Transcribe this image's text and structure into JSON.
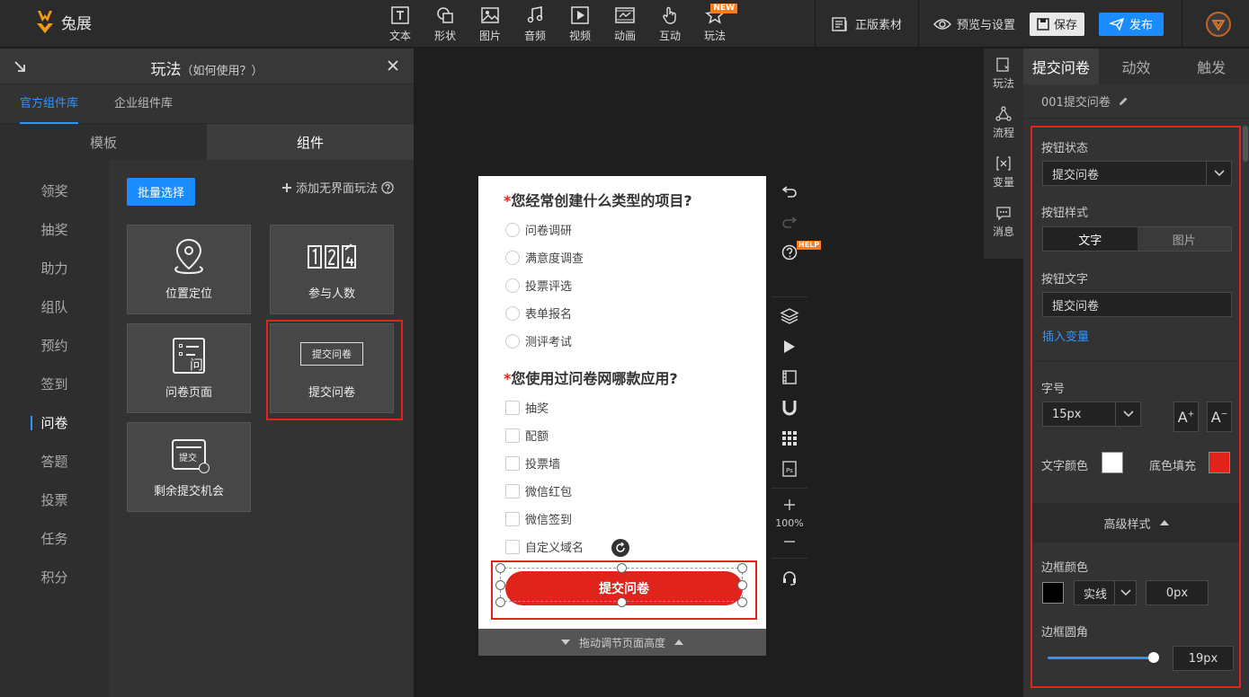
{
  "app": {
    "logo_text": "兔展"
  },
  "toolbar": {
    "tools": [
      {
        "label": "文本",
        "icon": "text-icon"
      },
      {
        "label": "形状",
        "icon": "shape-icon"
      },
      {
        "label": "图片",
        "icon": "image-icon"
      },
      {
        "label": "音频",
        "icon": "music-icon"
      },
      {
        "label": "视频",
        "icon": "video-icon"
      },
      {
        "label": "动画",
        "icon": "animation-icon"
      },
      {
        "label": "互动",
        "icon": "touch-icon"
      },
      {
        "label": "玩法",
        "icon": "star-icon",
        "badge": "NEW"
      }
    ],
    "genuine_assets": "正版素材",
    "preview_settings": "预览与设置",
    "save": "保存",
    "publish": "发布"
  },
  "left_panel": {
    "title": "玩法",
    "title_hint": "（如何使用？）",
    "lib_tabs": [
      "官方组件库",
      "企业组件库"
    ],
    "segments": [
      "模板",
      "组件"
    ],
    "categories": [
      "领奖",
      "抽奖",
      "助力",
      "组队",
      "预约",
      "签到",
      "问卷",
      "答题",
      "投票",
      "任务",
      "积分"
    ],
    "active_category": "问卷",
    "batch_select": "批量选择",
    "add_play": "添加无界面玩法",
    "cards": [
      {
        "label": "位置定位",
        "icon": "location-pin-icon"
      },
      {
        "label": "参与人数",
        "icon": "counter-icon"
      },
      {
        "label": "问卷页面",
        "icon": "questionnaire-icon",
        "icon_char": "问"
      },
      {
        "label": "提交问卷",
        "icon": "submit-button-icon",
        "mini_button": "提交问卷"
      },
      {
        "label": "剩余提交机会",
        "icon": "submit-chance-icon",
        "icon_char": "提交"
      }
    ]
  },
  "canvas": {
    "q1": {
      "title": "您经常创建什么类型的项目?",
      "options": [
        "问卷调研",
        "满意度调查",
        "投票评选",
        "表单报名",
        "测评考试"
      ]
    },
    "q2": {
      "title": "您使用过问卷网哪款应用?",
      "options": [
        "抽奖",
        "配额",
        "投票墙",
        "微信红包",
        "微信签到",
        "自定义域名"
      ]
    },
    "submit_label": "提交问卷",
    "drag_bar": "拖动调节页面高度",
    "zoom": "100%",
    "help_badge": "HELP"
  },
  "mini_bar": [
    {
      "label": "玩法",
      "icon": "play-method-icon"
    },
    {
      "label": "流程",
      "icon": "flow-icon"
    },
    {
      "label": "变量",
      "icon": "variable-icon"
    },
    {
      "label": "消息",
      "icon": "message-icon"
    }
  ],
  "right_panel": {
    "tabs": [
      "提交问卷",
      "动效",
      "触发"
    ],
    "component_name": "001提交问卷",
    "button_state_label": "按钮状态",
    "button_state_value": "提交问卷",
    "button_style_label": "按钮样式",
    "style_options": [
      "文字",
      "图片"
    ],
    "button_text_label": "按钮文字",
    "button_text_value": "提交问卷",
    "insert_variable": "插入变量",
    "font_size_label": "字号",
    "font_size_value": "15px",
    "text_color_label": "文字颜色",
    "fill_color_label": "底色填充",
    "text_color": "#ffffff",
    "fill_color": "#e0241c",
    "advanced_label": "高级样式",
    "border_color_label": "边框颜色",
    "border_color": "#000000",
    "border_style": "实线",
    "border_width": "0px",
    "border_radius_label": "边框圆角",
    "border_radius": "19px",
    "border_radius_level": 0.95
  }
}
